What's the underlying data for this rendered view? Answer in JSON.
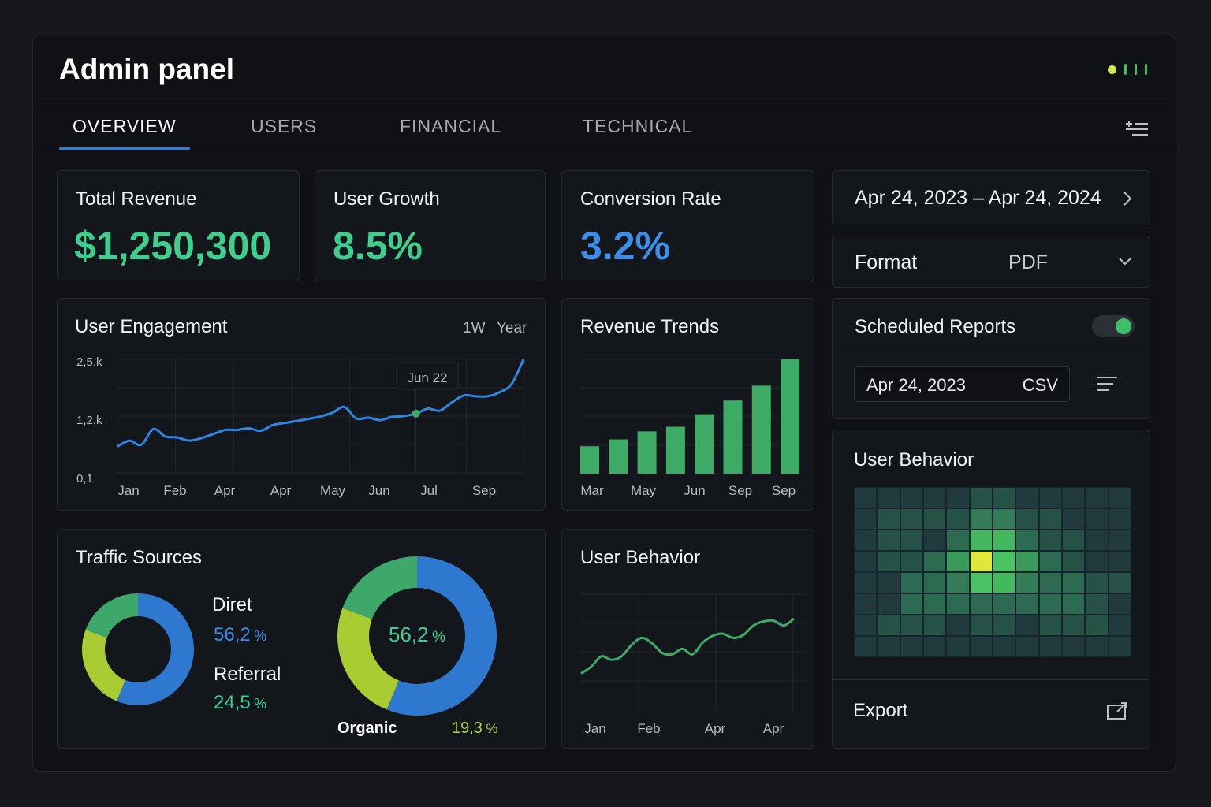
{
  "app": {
    "title": "Admin panel"
  },
  "tabs": [
    {
      "label": "OVERVIEW",
      "active": true
    },
    {
      "label": "USERS",
      "active": false
    },
    {
      "label": "FINANCIAL",
      "active": false
    },
    {
      "label": "TECHNICAL",
      "active": false
    }
  ],
  "kpis": {
    "revenue": {
      "label": "Total Revenue",
      "value": "$1,250,300",
      "color": "#3ecf8e"
    },
    "growth": {
      "label": "User Growth",
      "value": "8.5%",
      "color": "#3ecf8e"
    },
    "conversion": {
      "label": "Conversion Rate",
      "value": "3.2%",
      "color": "#3d8ee8"
    }
  },
  "report": {
    "date_range": "Apr 24, 2023 – Apr 24, 2024",
    "format_label": "Format",
    "format_value": "PDF",
    "scheduled_label": "Scheduled Reports",
    "scheduled_enabled": true,
    "scheduled_date": "Apr 24, 2023",
    "scheduled_format": "CSV"
  },
  "engagement": {
    "title": "User Engagement",
    "range_options": [
      "1W",
      "Year"
    ],
    "tooltip": "Jun 22"
  },
  "revenue_trends": {
    "title": "Revenue Trends"
  },
  "traffic": {
    "title": "Traffic Sources",
    "direct_label": "Diret",
    "direct_value": "56,2",
    "referral_label": "Referral",
    "referral_value": "24,5",
    "center_value": "56,2",
    "organic_label": "Organic",
    "organic_value": "19,3",
    "percent_sign": "%"
  },
  "behavior_line": {
    "title": "User Behavior"
  },
  "behavior_heatmap": {
    "title": "User Behavior",
    "export_label": "Export"
  },
  "chart_data": [
    {
      "type": "line",
      "title": "User Engagement",
      "x_ticks": [
        "Jan",
        "Feb",
        "Apr",
        "Apr",
        "May",
        "Jun",
        "Jul",
        "Sep"
      ],
      "y_ticks": [
        "2,5.k",
        "1,2.k",
        "0,1"
      ],
      "ylim": [
        100,
        2500
      ],
      "grid": true,
      "series": [
        {
          "color": "#2f86e0",
          "values": [
            380,
            520,
            420,
            800,
            620,
            600,
            520,
            580,
            680,
            780,
            780,
            820,
            760,
            900,
            950,
            1000,
            1050,
            1110,
            1200,
            1340,
            1060,
            1080,
            1020,
            1100,
            1120,
            1180,
            1300,
            1250,
            1450,
            1620,
            1600,
            1600,
            1700,
            1900,
            2500
          ]
        }
      ],
      "highlight": {
        "x_index": 25,
        "label": "Jun 22"
      }
    },
    {
      "type": "bar",
      "title": "Revenue Trends",
      "categories": [
        "Mar",
        "",
        "May",
        "",
        "Jun",
        "",
        "Sep",
        "Sep"
      ],
      "x_ticks": [
        "Mar",
        "May",
        "Jun",
        "Sep",
        "Sep"
      ],
      "values": [
        24,
        30,
        37,
        41,
        52,
        64,
        77,
        100
      ],
      "ylim": [
        0,
        100
      ],
      "color": "#3daa66"
    },
    {
      "type": "pie",
      "title": "Traffic Sources",
      "slices": [
        {
          "label": "Direct",
          "value": 56.2,
          "color": "#2f78cf"
        },
        {
          "label": "Referral",
          "value": 24.5,
          "color": "#a9cc32"
        },
        {
          "label": "Organic",
          "value": 19.3,
          "color": "#3ea86a"
        }
      ]
    },
    {
      "type": "line",
      "title": "User Behavior",
      "x_ticks": [
        "Jan",
        "Feb",
        "Apr",
        "Apr"
      ],
      "series": [
        {
          "color": "#3daa66",
          "values": [
            20,
            30,
            45,
            40,
            45,
            62,
            72,
            64,
            50,
            48,
            56,
            48,
            65,
            75,
            78,
            72,
            76,
            90,
            96,
            97,
            90,
            100
          ]
        }
      ],
      "grid": true
    },
    {
      "type": "heatmap",
      "title": "User Behavior",
      "rows": 8,
      "cols": 12,
      "values": [
        [
          1,
          1,
          1,
          1,
          1,
          2,
          2,
          1,
          1,
          1,
          1,
          1
        ],
        [
          1,
          2,
          2,
          2,
          2,
          4,
          4,
          2,
          2,
          1,
          1,
          1
        ],
        [
          1,
          2,
          2,
          1,
          3,
          6,
          6,
          3,
          2,
          2,
          1,
          1
        ],
        [
          1,
          2,
          2,
          3,
          5,
          9,
          7,
          5,
          3,
          2,
          1,
          1
        ],
        [
          1,
          1,
          3,
          3,
          4,
          7,
          6,
          4,
          3,
          3,
          2,
          2
        ],
        [
          1,
          1,
          3,
          3,
          3,
          3,
          3,
          3,
          3,
          3,
          2,
          1
        ],
        [
          1,
          2,
          2,
          2,
          1,
          2,
          2,
          1,
          2,
          2,
          2,
          1
        ],
        [
          1,
          1,
          1,
          1,
          1,
          1,
          1,
          1,
          1,
          1,
          1,
          1
        ]
      ]
    }
  ]
}
